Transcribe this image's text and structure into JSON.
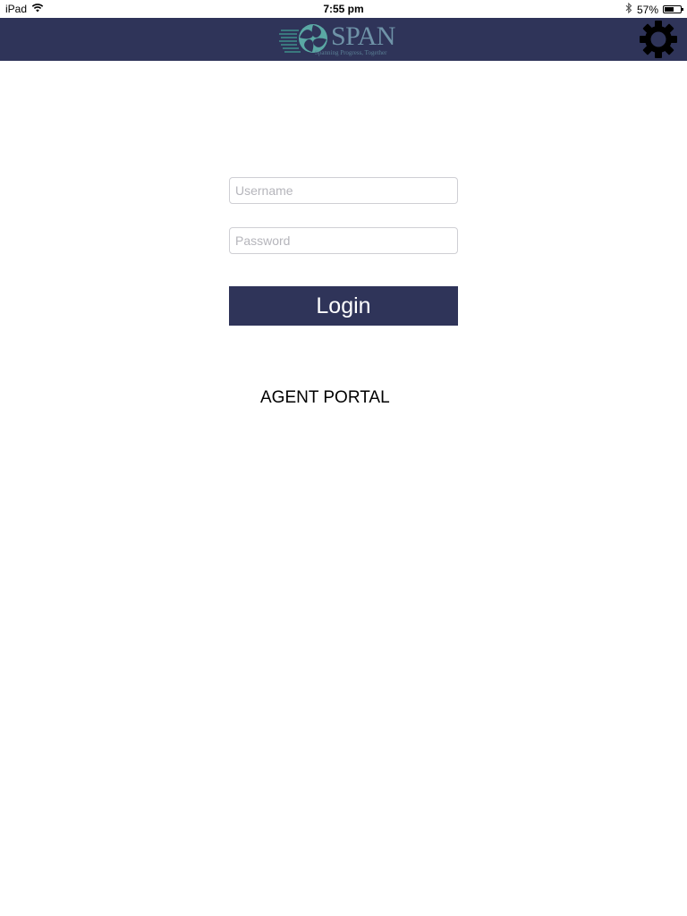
{
  "status_bar": {
    "device": "iPad",
    "time": "7:55 pm",
    "battery_percent": "57%",
    "battery_level": 0.57,
    "icons": [
      "wifi-icon",
      "bluetooth-icon",
      "battery-icon"
    ]
  },
  "header": {
    "logo_text": "SPAN",
    "logo_tagline": "Spanning Progress, Together",
    "settings_icon": "gear-icon",
    "background_color": "#2f3459",
    "logo_color": "#6f93a8"
  },
  "login_form": {
    "username_placeholder": "Username",
    "username_value": "",
    "password_placeholder": "Password",
    "password_value": "",
    "login_label": "Login",
    "button_color": "#2f3459"
  },
  "portal_label": "AGENT PORTAL"
}
